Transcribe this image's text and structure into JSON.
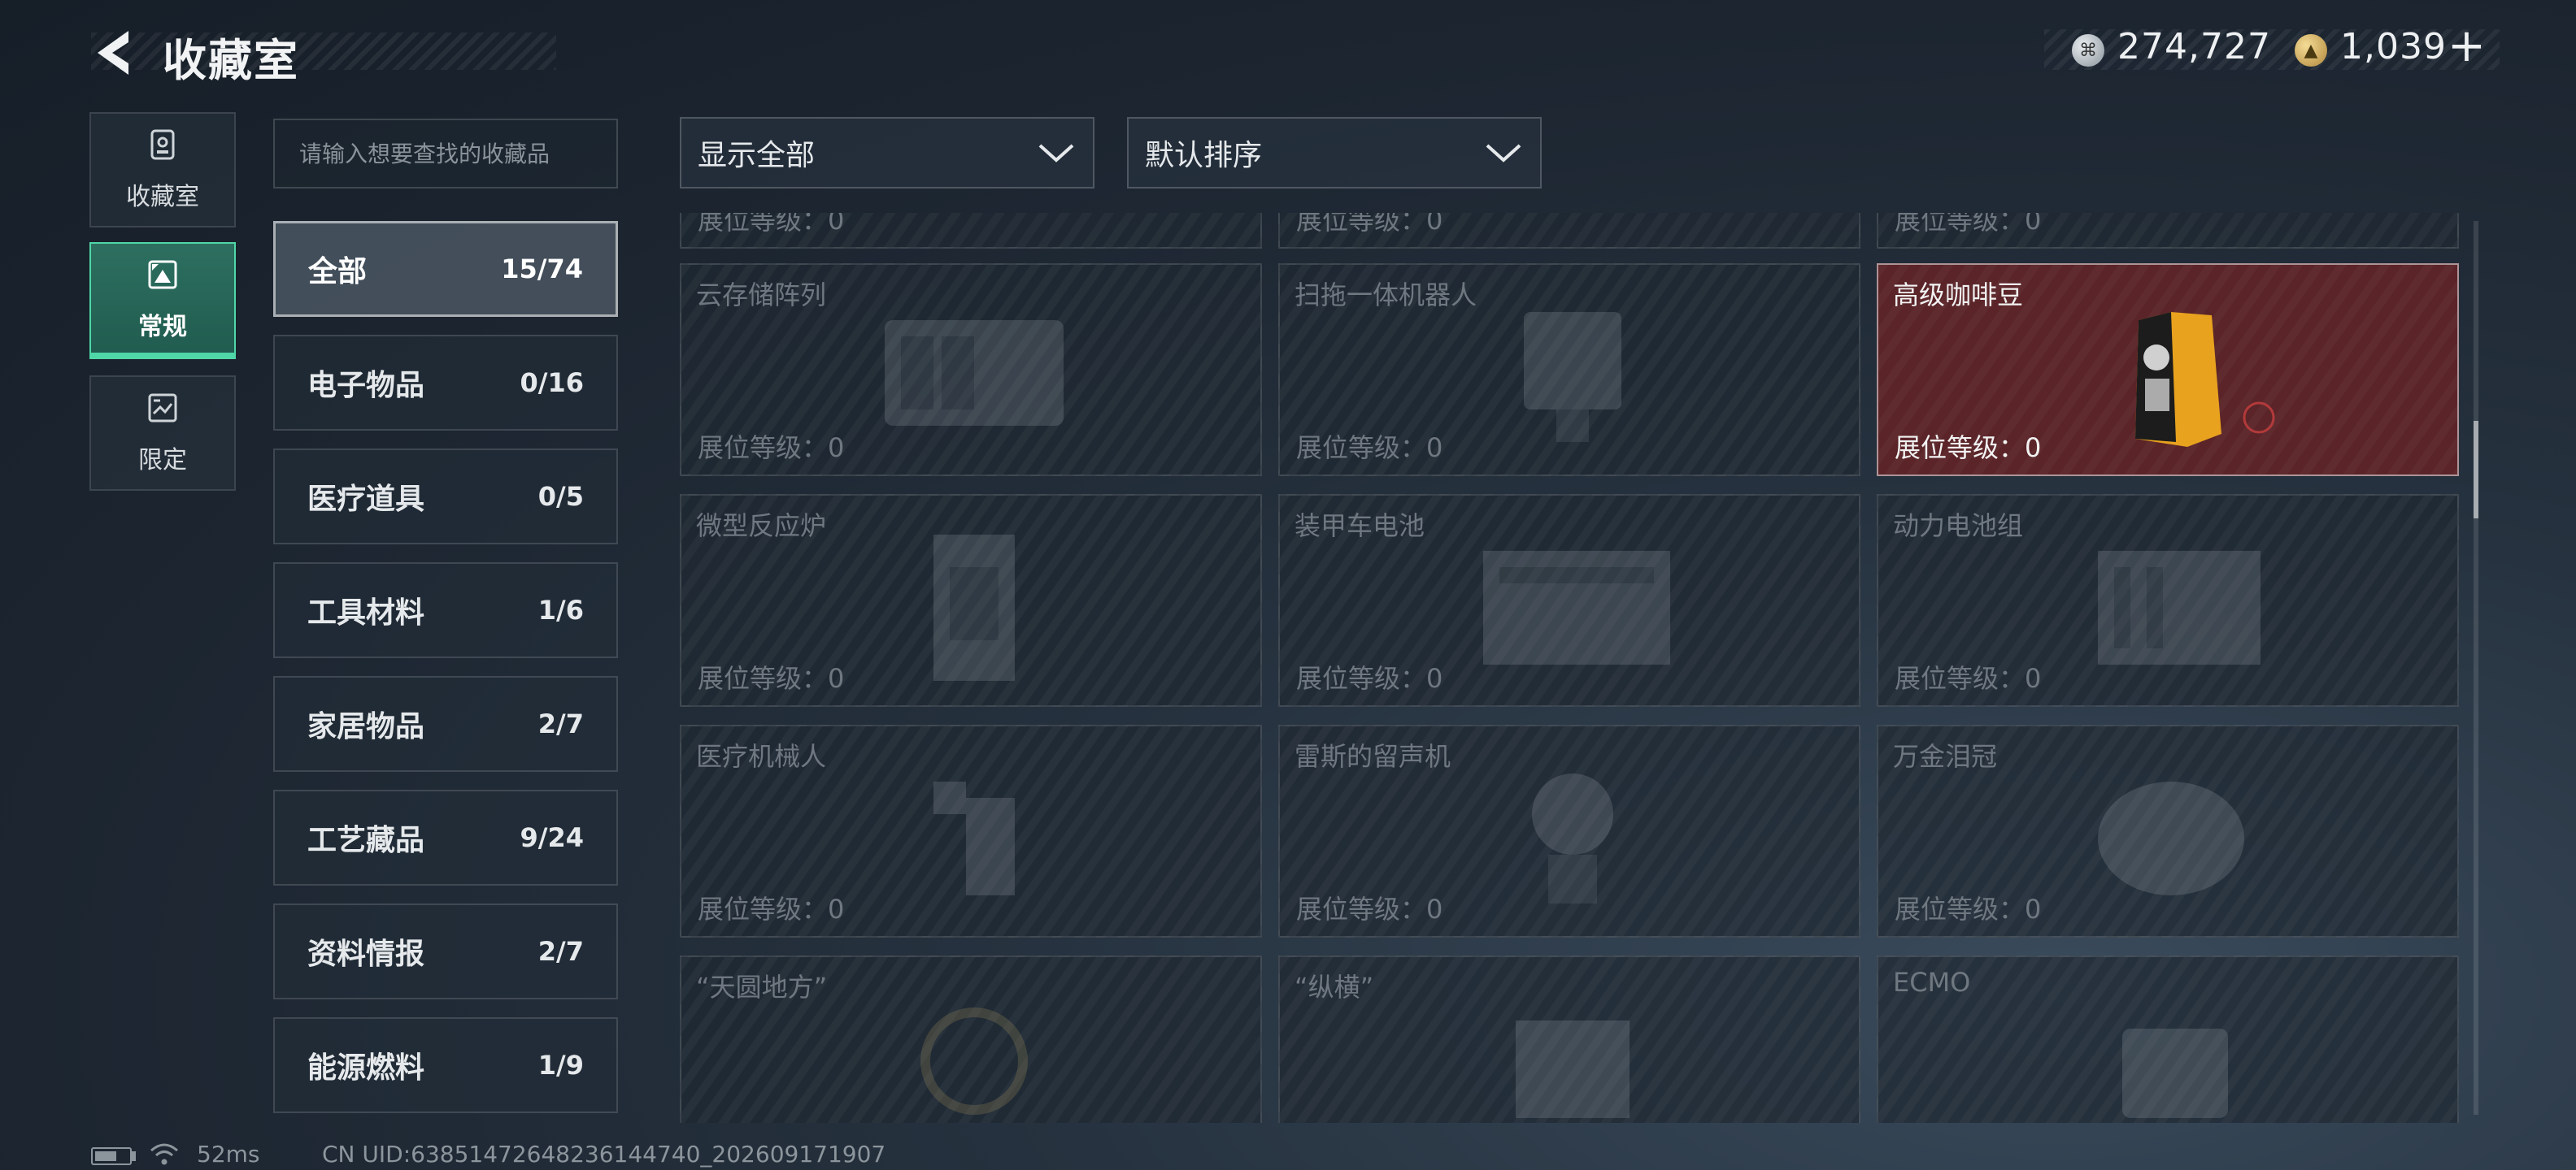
{
  "header": {
    "title": "收藏室"
  },
  "currency": {
    "silver_value": "274,727",
    "gold_value": "1,039",
    "add_symbol": "+"
  },
  "nav": [
    {
      "label": "收藏室",
      "icon": "collection-room-icon"
    },
    {
      "label": "常规",
      "icon": "regular-icon",
      "active": true
    },
    {
      "label": "限定",
      "icon": "limited-icon"
    }
  ],
  "search": {
    "placeholder": "请输入想要查找的收藏品"
  },
  "categories": [
    {
      "label": "全部",
      "count": "15/74",
      "active": true
    },
    {
      "label": "电子物品",
      "count": "0/16"
    },
    {
      "label": "医疗道具",
      "count": "0/5"
    },
    {
      "label": "工具材料",
      "count": "1/6"
    },
    {
      "label": "家居物品",
      "count": "2/7"
    },
    {
      "label": "工艺藏品",
      "count": "9/24"
    },
    {
      "label": "资料情报",
      "count": "2/7"
    },
    {
      "label": "能源燃料",
      "count": "1/9"
    }
  ],
  "filters": {
    "display": "显示全部",
    "sort": "默认排序"
  },
  "level_label": "展位等级：0",
  "items": [
    {
      "name": "",
      "owned": false
    },
    {
      "name": "",
      "owned": false
    },
    {
      "name": "",
      "owned": false
    },
    {
      "name": "云存储阵列",
      "owned": false
    },
    {
      "name": "扫拖一体机器人",
      "owned": false
    },
    {
      "name": "高级咖啡豆",
      "owned": true
    },
    {
      "name": "微型反应炉",
      "owned": false
    },
    {
      "name": "装甲车电池",
      "owned": false
    },
    {
      "name": "动力电池组",
      "owned": false
    },
    {
      "name": "医疗机械人",
      "owned": false
    },
    {
      "name": "雷斯的留声机",
      "owned": false
    },
    {
      "name": "万金泪冠",
      "owned": false
    },
    {
      "name": "“天圆地方”",
      "owned": false
    },
    {
      "name": "“纵横”",
      "owned": false
    },
    {
      "name": "ECMO",
      "owned": false
    }
  ],
  "status": {
    "ping": "52ms",
    "uid": "CN UID:638514726482361447​40_202609171907"
  }
}
